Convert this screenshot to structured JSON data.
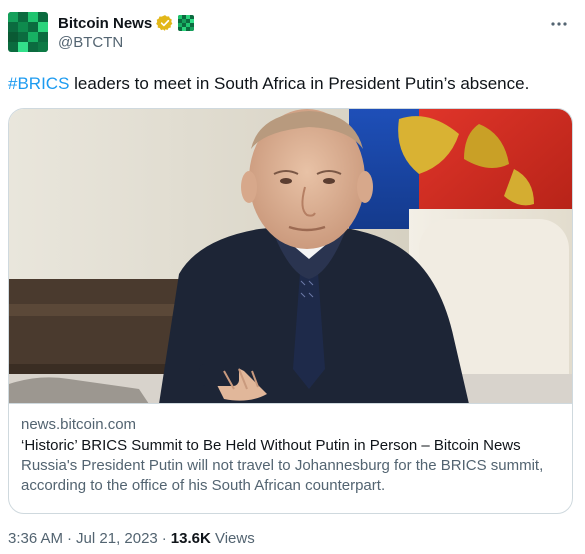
{
  "author": {
    "display_name": "Bitcoin News",
    "handle": "@BTCTN",
    "avatar_icon": "checkered-green-logo",
    "verified_badge_color": "#e2b719"
  },
  "tweet": {
    "hashtag": "#BRICS",
    "text": " leaders to meet in South Africa in President Putin’s absence."
  },
  "card": {
    "domain": "news.bitcoin.com",
    "title": "‘Historic’ BRICS Summit to Be Held Without Putin in Person – Bitcoin News",
    "description": "Russia's President Putin will not travel to Johannesburg for the BRICS summit, according to the office of his South African counterpart."
  },
  "meta": {
    "time": "3:36 AM",
    "separator": "·",
    "date": "Jul 21, 2023",
    "views_count": "13.6K",
    "views_label": "Views"
  },
  "colors": {
    "link": "#1d9bf0",
    "secondary_text": "#536471",
    "primary_text": "#0f1419",
    "brand_green": "#0b5e3a"
  }
}
